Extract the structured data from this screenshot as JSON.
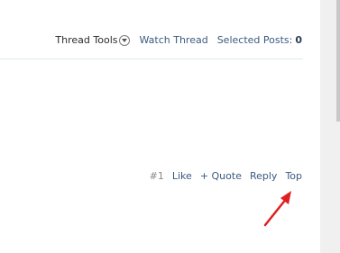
{
  "thread_toolbar": {
    "thread_tools_label": "Thread Tools",
    "thread_tools_icon": "chevron-down-circle-icon",
    "watch_thread_label": "Watch Thread",
    "selected_posts_label": "Selected Posts:",
    "selected_posts_count": "0"
  },
  "post_controls": {
    "post_number": "#1",
    "like_label": "Like",
    "quote_label": "+ Quote",
    "reply_label": "Reply",
    "top_label": "Top"
  },
  "annotation": {
    "icon": "red-arrow-icon",
    "color": "#e02020"
  },
  "colors": {
    "link": "#3a5a7f",
    "divider": "#d6eee6"
  }
}
